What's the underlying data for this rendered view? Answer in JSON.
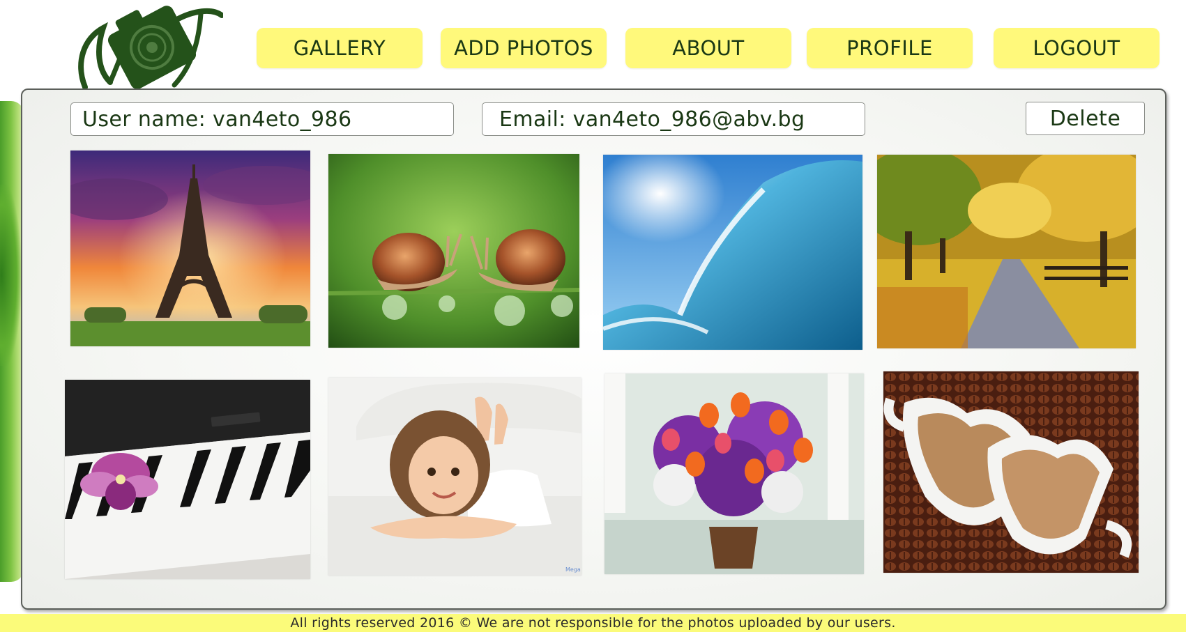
{
  "nav": {
    "gallery_label": "GALLERY",
    "add_photos_label": "ADD PHOTOS",
    "about_label": "ABOUT",
    "profile_label": "PROFILE",
    "logout_label": "LOGOUT"
  },
  "profile": {
    "username_text": "User name: van4eto_986",
    "email_text": "Email:  van4eto_986@abv.bg",
    "delete_label": "Delete"
  },
  "photos": [
    "eiffel-tower-sunset",
    "two-snails-on-dewdrops",
    "ocean-wave",
    "autumn-tree-lined-road",
    "yamaha-keyboard-with-orchid",
    "smiling-girl-on-bed",
    "flower-bouquet-in-basket",
    "heart-shaped-coffee-cups"
  ],
  "photo_watermark": "Mega",
  "footer": {
    "text": "All rights reserved 2016 ©  We are not responsible for the photos uploaded by our users."
  },
  "colors": {
    "nav_button": "#fff97b",
    "nav_text": "#1a3814",
    "footer_bar": "#fbfb7a",
    "panel_border": "#5b5f5a",
    "logo_green": "#24521a"
  },
  "icons": {
    "logo": "camera-logo-icon"
  }
}
